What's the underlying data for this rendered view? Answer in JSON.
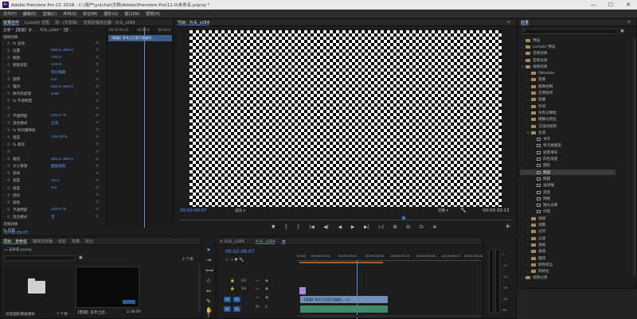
{
  "window": {
    "app_icon": "Pr",
    "title": "Adobe Premiere Pro CC 2018 - C:\\用户\\yuichai\\文档\\Adobe\\Premiere Pro\\12.0\\未命名.prproj *",
    "minimize": "—",
    "maximize": "☐",
    "close": "✕"
  },
  "menu": [
    "文件(F)",
    "编辑(E)",
    "剪辑(C)",
    "序列(S)",
    "标记(M)",
    "图形(G)",
    "窗口(W)",
    "帮助(H)"
  ],
  "effect_controls": {
    "tabs": [
      "效果控件",
      "Lumetri 范围",
      "源：(无剪辑)",
      "音频剪辑混合器：片头_x264"
    ],
    "mini_tabs": [
      "节目：片头_x264"
    ],
    "header_source": "主要 *【夏趣】多...",
    "header_seq": "片头_x264 *【夏...",
    "time_labels": [
      "00:00:09:22",
      "00:00:0",
      "00:00:0"
    ],
    "clip_label": "【夏趣】多年之后我又穿越回...",
    "section_video": "视频效果",
    "rows": [
      {
        "label": "fx 运动",
        "value": ""
      },
      {
        "label": "位置",
        "value": "640.0   360.0"
      },
      {
        "label": "缩放",
        "value": "100.0"
      },
      {
        "label": "缩放宽度",
        "value": "100.0"
      },
      {
        "label": "",
        "value": "等比缩放"
      },
      {
        "label": "旋转",
        "value": "0.0"
      },
      {
        "label": "锚点",
        "value": "640.0   360.0"
      },
      {
        "label": "防闪烁滤镜",
        "value": "0.00"
      },
      {
        "label": "fx 不透明度",
        "value": ""
      },
      {
        "label": "",
        "value": ""
      },
      {
        "label": "不透明度",
        "value": "100.0 %"
      },
      {
        "label": "混合模式",
        "value": "正常"
      },
      {
        "label": "fx 时间重映射",
        "value": ""
      },
      {
        "label": "速度",
        "value": "100.00%"
      },
      {
        "label": "fx 裁剪",
        "value": ""
      },
      {
        "label": "",
        "value": ""
      },
      {
        "label": "描边",
        "value": "640.0   360.0"
      },
      {
        "label": "大小来源",
        "value": "图层源宽"
      },
      {
        "label": "宽高",
        "value": ""
      },
      {
        "label": "宽度",
        "value": "16.0"
      },
      {
        "label": "高度",
        "value": "0.0"
      },
      {
        "label": "羽化",
        "value": ""
      },
      {
        "label": "颜色",
        "value": ""
      },
      {
        "label": "不透明度",
        "value": "100.0 %"
      },
      {
        "label": "混合模式",
        "value": "无"
      }
    ],
    "section_audio": "音频效果",
    "audio_row": "fx 音量",
    "timecode": "00:02:09:07"
  },
  "program": {
    "title": "节目：片头_x264",
    "menu_icon": "≡",
    "timecode_left": "00:02:09:07",
    "fit": "适合",
    "quality": "完整",
    "timecode_right": "00:03:10:13",
    "controls": [
      "▼",
      "{",
      "}",
      "|◀",
      "◀|",
      "◀",
      "▶",
      "▶|",
      "▷|",
      "⊞",
      "⊟",
      "⊡",
      "⊕"
    ],
    "add_button": "+"
  },
  "effects": {
    "title": "效果",
    "menu_icon": "≡",
    "tree": [
      {
        "indent": 0,
        "open": false,
        "type": "folder",
        "label": "预设"
      },
      {
        "indent": 0,
        "open": false,
        "type": "folder",
        "label": "Lumetri 预设"
      },
      {
        "indent": 0,
        "open": false,
        "type": "folder",
        "label": "音频效果"
      },
      {
        "indent": 0,
        "open": false,
        "type": "folder",
        "label": "音频过渡"
      },
      {
        "indent": 0,
        "open": true,
        "type": "folder",
        "label": "视频效果"
      },
      {
        "indent": 1,
        "open": false,
        "type": "folder",
        "label": "Obsolete"
      },
      {
        "indent": 1,
        "open": false,
        "type": "folder",
        "label": "变换"
      },
      {
        "indent": 1,
        "open": false,
        "type": "folder",
        "label": "图像控制"
      },
      {
        "indent": 1,
        "open": false,
        "type": "folder",
        "label": "实用程序"
      },
      {
        "indent": 1,
        "open": false,
        "type": "folder",
        "label": "扭曲"
      },
      {
        "indent": 1,
        "open": false,
        "type": "folder",
        "label": "时间"
      },
      {
        "indent": 1,
        "open": false,
        "type": "folder",
        "label": "杂色与颗粒"
      },
      {
        "indent": 1,
        "open": false,
        "type": "folder",
        "label": "模糊与锐化"
      },
      {
        "indent": 1,
        "open": false,
        "type": "folder",
        "label": "沉浸式视频"
      },
      {
        "indent": 1,
        "open": true,
        "type": "folder",
        "label": "生成"
      },
      {
        "indent": 2,
        "open": false,
        "type": "fx",
        "label": "书写"
      },
      {
        "indent": 2,
        "open": false,
        "type": "fx",
        "label": "单元格图案"
      },
      {
        "indent": 2,
        "open": false,
        "type": "fx",
        "label": "吸管填充"
      },
      {
        "indent": 2,
        "open": false,
        "type": "fx",
        "label": "四色渐变"
      },
      {
        "indent": 2,
        "open": false,
        "type": "fx",
        "label": "圆形"
      },
      {
        "indent": 2,
        "open": false,
        "type": "fx",
        "label": "棋盘",
        "selected": true
      },
      {
        "indent": 2,
        "open": false,
        "type": "fx",
        "label": "椭圆"
      },
      {
        "indent": 2,
        "open": false,
        "type": "fx",
        "label": "油漆桶"
      },
      {
        "indent": 2,
        "open": false,
        "type": "fx",
        "label": "渐变"
      },
      {
        "indent": 2,
        "open": false,
        "type": "fx",
        "label": "网格"
      },
      {
        "indent": 2,
        "open": false,
        "type": "fx",
        "label": "镜头光晕"
      },
      {
        "indent": 2,
        "open": false,
        "type": "fx",
        "label": "闪电"
      },
      {
        "indent": 1,
        "open": false,
        "type": "folder",
        "label": "视频"
      },
      {
        "indent": 1,
        "open": false,
        "type": "folder",
        "label": "调整"
      },
      {
        "indent": 1,
        "open": false,
        "type": "folder",
        "label": "过时"
      },
      {
        "indent": 1,
        "open": false,
        "type": "folder",
        "label": "过渡"
      },
      {
        "indent": 1,
        "open": false,
        "type": "folder",
        "label": "透视"
      },
      {
        "indent": 1,
        "open": false,
        "type": "folder",
        "label": "通道"
      },
      {
        "indent": 1,
        "open": false,
        "type": "folder",
        "label": "键控"
      },
      {
        "indent": 1,
        "open": false,
        "type": "folder",
        "label": "颜色校正"
      },
      {
        "indent": 1,
        "open": false,
        "type": "folder",
        "label": "风格化"
      },
      {
        "indent": 0,
        "open": false,
        "type": "folder",
        "label": "视频过渡"
      }
    ]
  },
  "project": {
    "tabs": [
      "项目：未命名",
      "媒体浏览器",
      "信息",
      "效果",
      "标记"
    ],
    "file_name": "未命名.prproj",
    "count": "2 个项",
    "items": [
      {
        "label": "动态图形模板媒体",
        "meta": "7 个项"
      },
      {
        "label": "【夏趣】多年之后...",
        "meta": "2:38:00"
      }
    ]
  },
  "timeline": {
    "tabs": [
      "片头_x264",
      "片头_x264"
    ],
    "menu_icon": "≡",
    "timecode": "00:02:09:07",
    "ruler": [
      "00:00",
      "00:00:09:22",
      "00:00:19:21",
      "00:00:29:20",
      "00:00:39:19",
      "00:00:49:18",
      "00:00:59:17",
      "00:01:09:16"
    ],
    "tracks": [
      "V3",
      "V2",
      "V1",
      "A1"
    ],
    "clip_label": "【夏趣】多年之后我又穿越回... [V]"
  },
  "meter": {
    "labels": [
      "0",
      "-12",
      "-24",
      "-36",
      "-48",
      "dB"
    ],
    "solo": [
      "S",
      "S"
    ]
  },
  "tools": [
    "selection-tool",
    "track-select-tool",
    "ripple-edit-tool",
    "razor-tool",
    "slip-tool",
    "pen-tool",
    "hand-tool",
    "type-tool"
  ]
}
